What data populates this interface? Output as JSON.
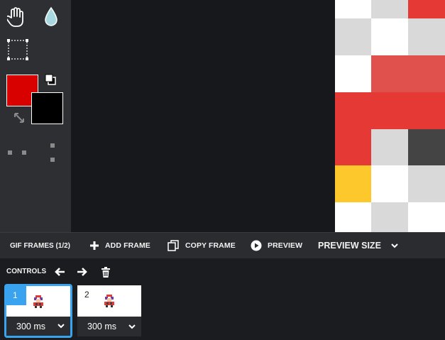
{
  "tools": {
    "items": [
      {
        "name": "hand-icon"
      },
      {
        "name": "eyedropper-icon"
      },
      {
        "name": "marquee-select-icon"
      },
      {
        "name": "swap-colors-icon"
      },
      {
        "name": "reset-colors-icon"
      }
    ],
    "primary_color": "#d90000",
    "secondary_color": "#000000"
  },
  "frames_bar": {
    "title": "GIF FRAMES (1/2)",
    "add_frame": "ADD FRAME",
    "copy_frame": "COPY FRAME",
    "preview": "PREVIEW",
    "preview_size": "PREVIEW SIZE"
  },
  "controls": {
    "label": "CONTROLS"
  },
  "frames": [
    {
      "number": "1",
      "duration": "300 ms",
      "active": true
    },
    {
      "number": "2",
      "duration": "300 ms",
      "active": false
    }
  ],
  "colors": {
    "accent": "#3aa3f0",
    "red": "#e53935",
    "yellow": "#fdc82b",
    "light_gray": "#d9d9d9",
    "dark_gray": "#444444"
  }
}
